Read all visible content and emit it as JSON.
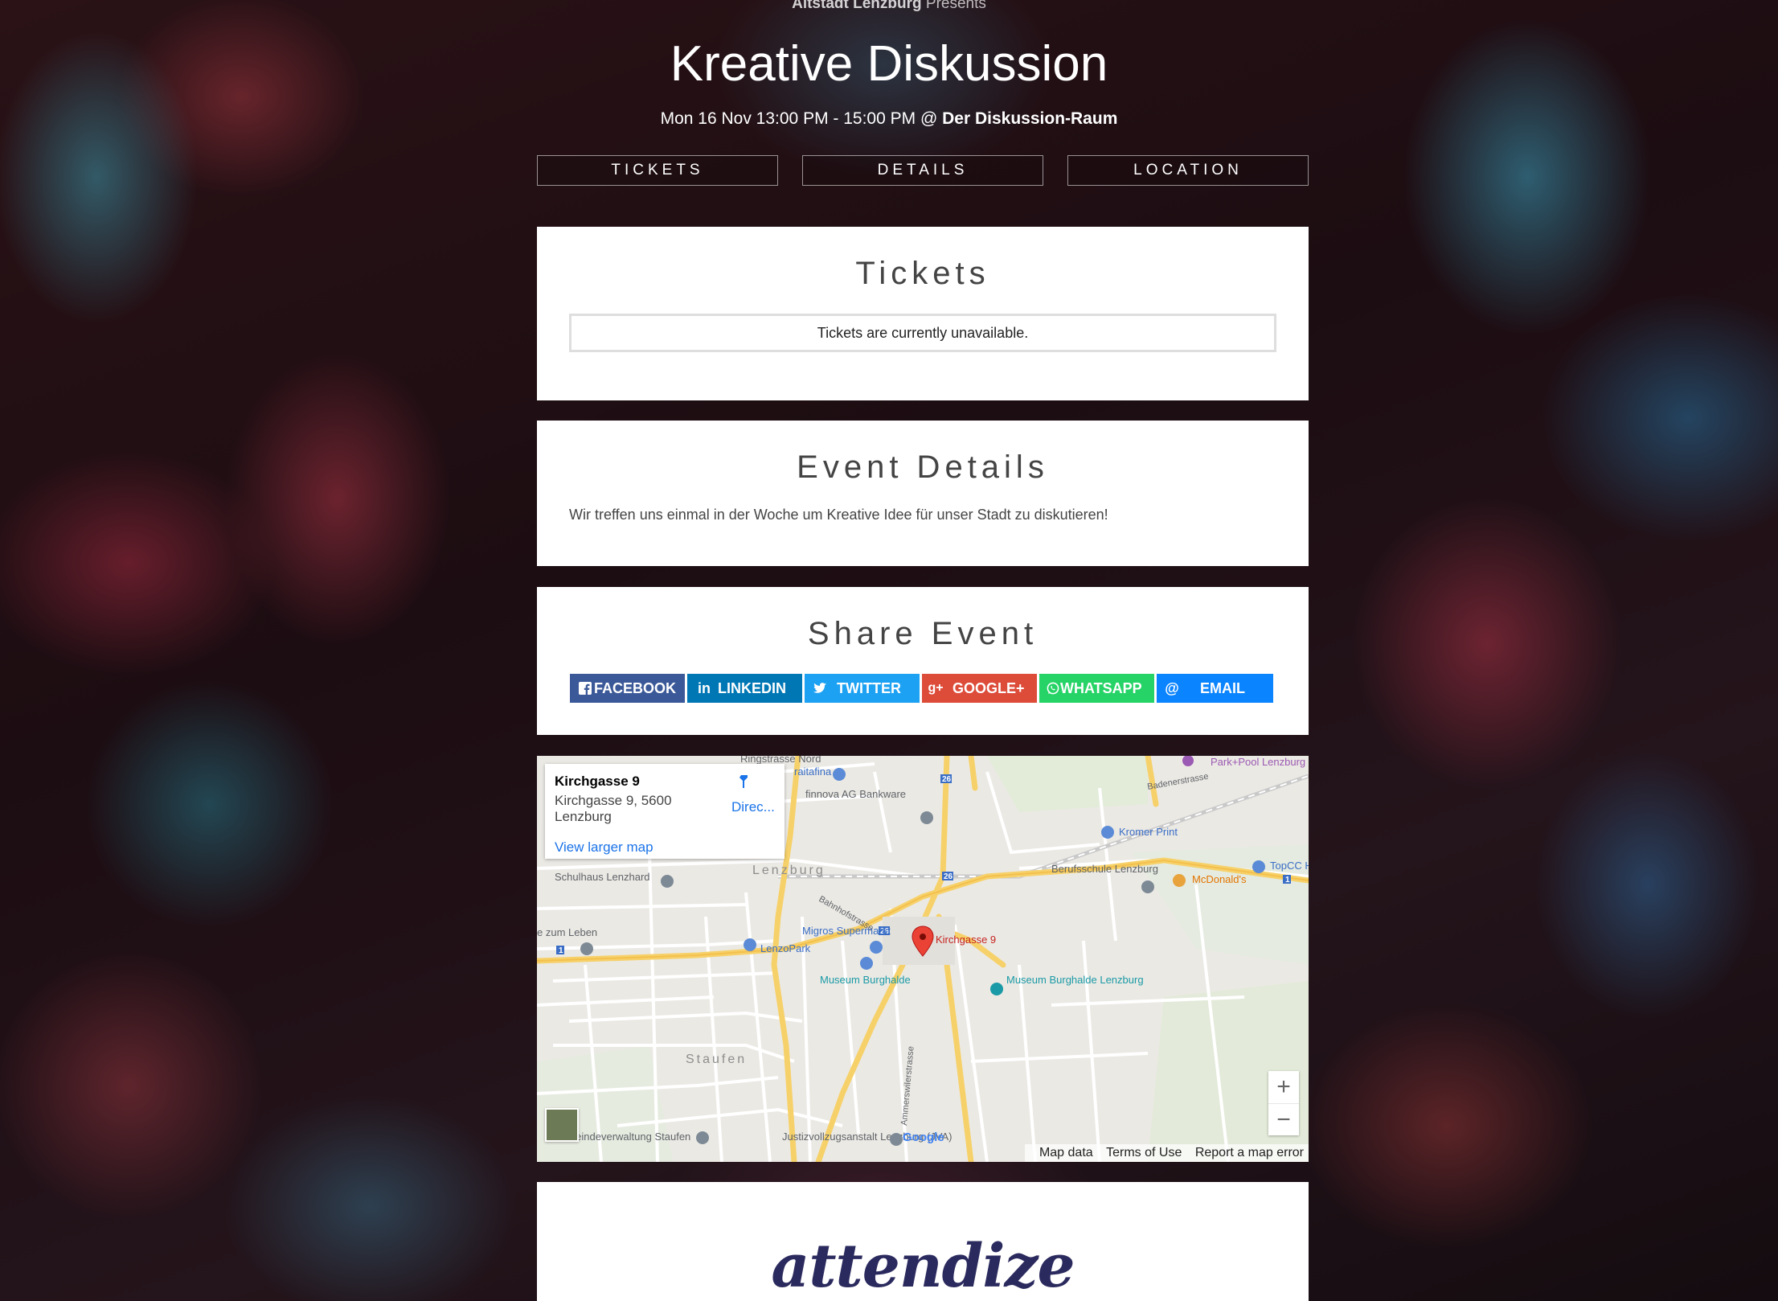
{
  "header": {
    "organiser": "Altstadt Lenzburg",
    "presents": "Presents",
    "title": "Kreative Diskussion",
    "datetime": "Mon 16 Nov 13:00 PM - 15:00 PM",
    "at": "@",
    "venue": "Der Diskussion-Raum"
  },
  "nav": {
    "tickets": "TICKETS",
    "details": "DETAILS",
    "location": "LOCATION"
  },
  "tickets": {
    "heading": "Tickets",
    "notice": "Tickets are currently unavailable."
  },
  "details": {
    "heading": "Event Details",
    "description": "Wir treffen uns einmal in der Woche um Kreative Idee für unser Stadt zu diskutieren!"
  },
  "share": {
    "heading": "Share Event",
    "buttons": [
      {
        "label": "FACEBOOK",
        "icon": "facebook-icon",
        "color": "#3b5998"
      },
      {
        "label": "LINKEDIN",
        "icon": "linkedin-icon",
        "color": "#0077b5"
      },
      {
        "label": "TWITTER",
        "icon": "twitter-icon",
        "color": "#1da1f2"
      },
      {
        "label": "GOOGLE+",
        "icon": "google-plus-icon",
        "color": "#dd4b39"
      },
      {
        "label": "WHATSAPP",
        "icon": "whatsapp-icon",
        "color": "#25d366"
      },
      {
        "label": "EMAIL",
        "icon": "at-icon",
        "color": "#0b84ff"
      }
    ]
  },
  "map": {
    "place_title": "Kirchgasse 9",
    "place_address": "Kirchgasse 9, 5600 Lenzburg",
    "directions": "Direc...",
    "larger_map": "View larger map",
    "marker_label": "Kirchgasse 9",
    "zoom_in": "+",
    "zoom_out": "−",
    "google": "Google",
    "footer": {
      "map_data": "Map data",
      "terms": "Terms of Use",
      "report": "Report a map error"
    },
    "labels": {
      "ringstrasse": "Ringstrasse Nord",
      "raitafina": "raitafina",
      "park_pool": "Park+Pool Lenzburg",
      "badenerstrasse": "Badenerstrasse",
      "finnova": "finnova AG Bankware",
      "kromer": "Kromer Print",
      "topcc": "TopCC Her",
      "lenzburg": "Lenzburg",
      "berufsschule": "Berufsschule Lenzburg",
      "mcdonalds": "McDonald's",
      "schulhaus": "Schulhaus Lenzhard",
      "bahnhofstrasse": "Bahnhofstrasse",
      "zum_leben": "e zum Leben",
      "migros": "Migros Supermarkt",
      "lenzopark": "LenzoPark",
      "museum_road": "Museum Burghalde",
      "museum_poi": "Museum Burghalde Lenzburg",
      "staufen": "Staufen",
      "gemeinde": "Gemeindeverwaltung Staufen",
      "jva": "Justizvollzugsanstalt Lenzburg (JVA)",
      "ammerswil": "Ammerswilerstrasse",
      "route26": "26",
      "route1": "1"
    }
  },
  "footer": {
    "logo": "attendize"
  }
}
